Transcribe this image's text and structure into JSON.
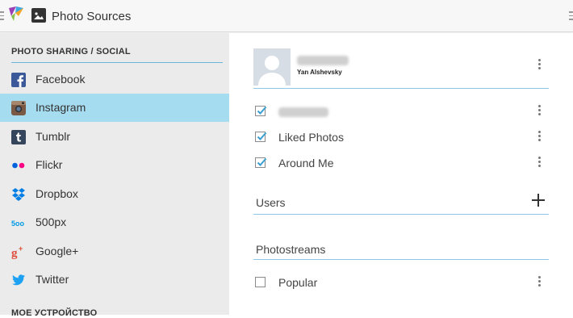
{
  "header": {
    "title": "Photo Sources",
    "logo_icon": "app-logo-icon",
    "title_icon": "photo-icon"
  },
  "sidebar": {
    "section_title": "PHOTO SHARING / SOCIAL",
    "bottom_section_title": "МОЕ УСТРОЙСТВО",
    "selected_color": "#a6dcf0",
    "items": [
      {
        "label": "Facebook",
        "icon": "facebook-icon"
      },
      {
        "label": "Instagram",
        "icon": "instagram-icon",
        "selected": true
      },
      {
        "label": "Tumblr",
        "icon": "tumblr-icon"
      },
      {
        "label": "Flickr",
        "icon": "flickr-icon"
      },
      {
        "label": "Dropbox",
        "icon": "dropbox-icon"
      },
      {
        "label": "500px",
        "icon": "500px-icon"
      },
      {
        "label": "Google+",
        "icon": "google-plus-icon"
      },
      {
        "label": "Twitter",
        "icon": "twitter-icon"
      }
    ]
  },
  "main": {
    "account": {
      "name": "Yan Alshevsky"
    },
    "feeds": [
      {
        "label": "",
        "checked": true,
        "blurred": true
      },
      {
        "label": "Liked Photos",
        "checked": true
      },
      {
        "label": "Around Me",
        "checked": true
      }
    ],
    "users_label": "Users",
    "photostreams_label": "Photostreams",
    "photostreams": [
      {
        "label": "Popular",
        "checked": false
      }
    ]
  }
}
